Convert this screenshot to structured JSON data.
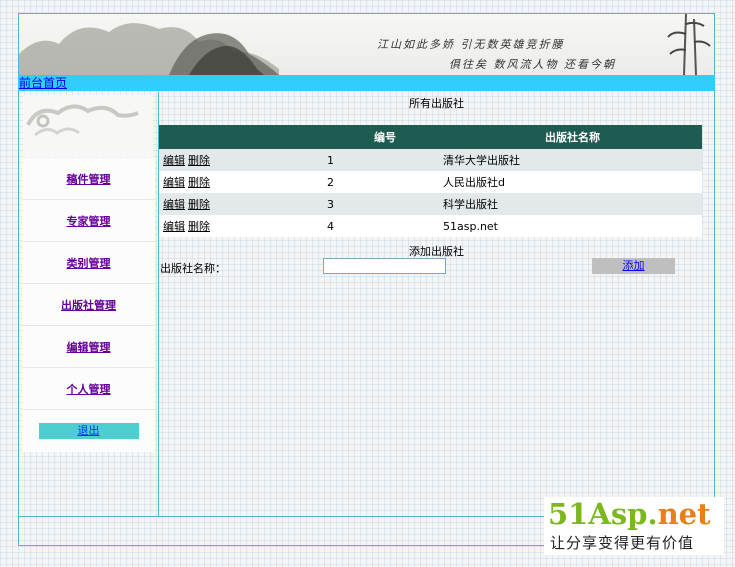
{
  "banner": {
    "line1": "江山如此多娇 引无数英雄竞折腰",
    "line2": "俱往矣 数风流人物 还看今朝"
  },
  "topbar": {
    "home_link": "前台首页"
  },
  "sidebar": {
    "items": [
      {
        "label": "稿件管理"
      },
      {
        "label": "专家管理"
      },
      {
        "label": "类别管理"
      },
      {
        "label": "出版社管理"
      },
      {
        "label": "编辑管理"
      },
      {
        "label": "个人管理"
      }
    ],
    "logout": "退出"
  },
  "main": {
    "list_title": "所有出版社",
    "table": {
      "headers": [
        "",
        "编号",
        "出版社名称"
      ],
      "edit_label": "编辑",
      "delete_label": "删除",
      "rows": [
        {
          "id": "1",
          "name": "清华大学出版社"
        },
        {
          "id": "2",
          "name": "人民出版社d"
        },
        {
          "id": "3",
          "name": "科学出版社"
        },
        {
          "id": "4",
          "name": "51asp.net"
        }
      ]
    },
    "add_title": "添加出版社",
    "add_label": "出版社名称：",
    "add_input_value": "",
    "add_button": "添加"
  },
  "watermark": {
    "brand_a": "51Asp.",
    "brand_b": "net",
    "slogan": "让分享变得更有价值"
  },
  "colors": {
    "topbar": "#33ccff",
    "table_header": "#1e5c52",
    "logout_button": "#4dcfcf",
    "frame_border": "#4fb7c8"
  }
}
